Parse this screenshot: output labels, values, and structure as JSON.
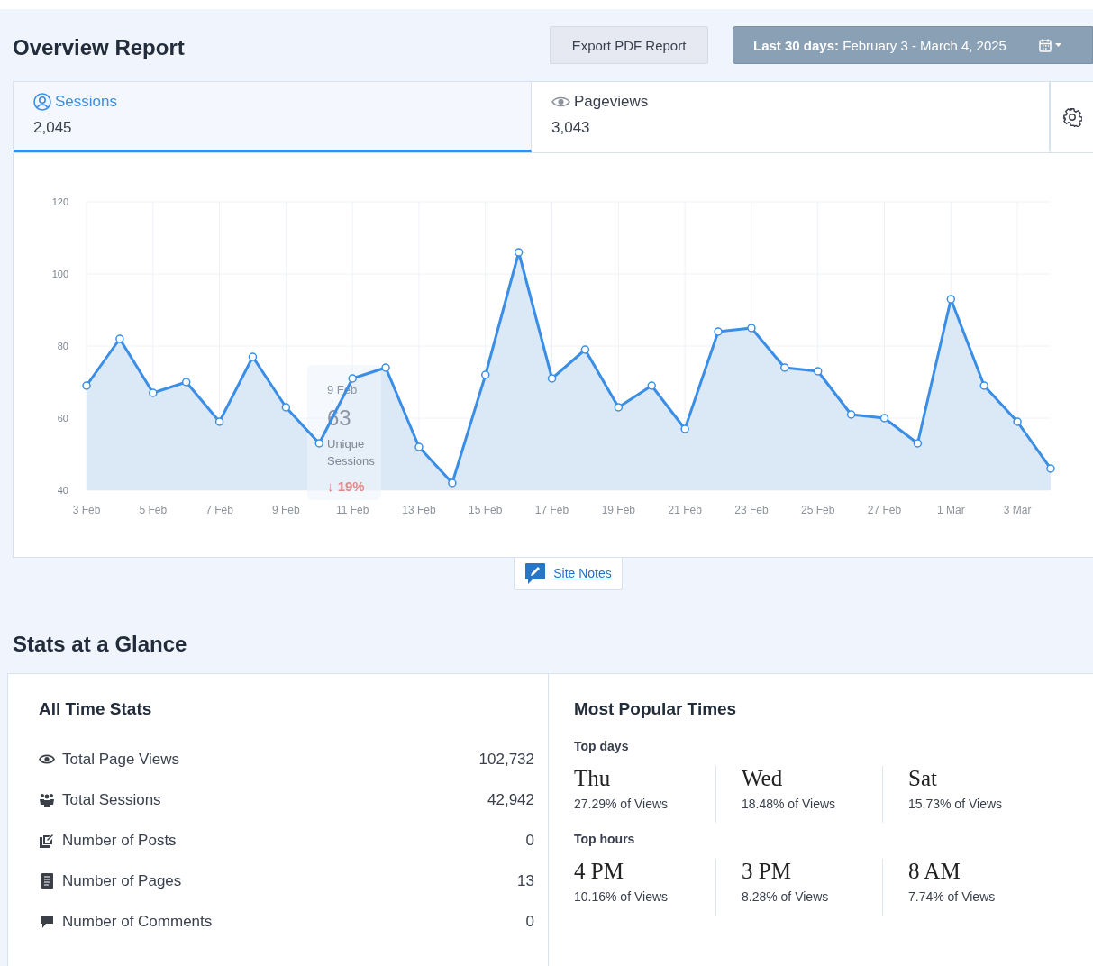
{
  "header": {
    "title": "Overview Report",
    "export_button": "Export PDF Report",
    "date_range": "**Last 30 days:** February 3 - March 4, 2025"
  },
  "tabs": [
    {
      "label": "Sessions",
      "value": "2,045",
      "selected": true
    },
    {
      "label": "Pageviews",
      "value": "3,043",
      "selected": false
    }
  ],
  "chart": {
    "chart_data": {
      "type": "area",
      "grid": true,
      "categories": [
        "3 Feb",
        null,
        "5 Feb",
        null,
        "7 Feb",
        null,
        "9 Feb",
        null,
        "11 Feb",
        null,
        "13 Feb",
        null,
        "15 Feb",
        null,
        "17 Feb",
        null,
        "19 Feb",
        null,
        "21 Feb",
        null,
        "23 Feb",
        null,
        "25 Feb",
        null,
        "27 Feb",
        null,
        "1 Mar",
        null,
        "3 Mar",
        null
      ],
      "ylim": [
        40,
        120
      ],
      "yticks": [
        40,
        60,
        80,
        100,
        120
      ],
      "series": [
        {
          "color": "#3a8ee6",
          "values": [
            69,
            82,
            67,
            70,
            59,
            77,
            63,
            53,
            71,
            74,
            52,
            42,
            72,
            106,
            71,
            79,
            63,
            69,
            57,
            84,
            85,
            74,
            73,
            61,
            60,
            53,
            93,
            69,
            59,
            46
          ]
        }
      ]
    },
    "tooltip": {
      "date": "9 Feb",
      "value": "63",
      "label": "Unique Sessions",
      "change": "↓ 19%"
    }
  },
  "site_notes": "Site Notes",
  "glance": {
    "title": "Stats at a Glance",
    "all_time": {
      "title": "All Time Stats",
      "rows": [
        {
          "label": "Total Page Views",
          "value": "102,732"
        },
        {
          "label": "Total Sessions",
          "value": "42,942"
        },
        {
          "label": "Number of Posts",
          "value": "0"
        },
        {
          "label": "Number of Pages",
          "value": "13"
        },
        {
          "label": "Number of Comments",
          "value": "0"
        }
      ]
    },
    "popular": {
      "title": "Most Popular Times",
      "groups": [
        {
          "title": "Top days",
          "items": [
            {
              "name": "Thu",
              "share": "27.29% of Views"
            },
            {
              "name": "Wed",
              "share": "18.48% of Views"
            },
            {
              "name": "Sat",
              "share": "15.73% of Views"
            }
          ]
        },
        {
          "title": "Top hours",
          "items": [
            {
              "name": "4 PM",
              "share": "10.16% of Views"
            },
            {
              "name": "3 PM",
              "share": "8.28% of Views"
            },
            {
              "name": "8 AM",
              "share": "7.74% of Views"
            }
          ]
        }
      ]
    }
  }
}
